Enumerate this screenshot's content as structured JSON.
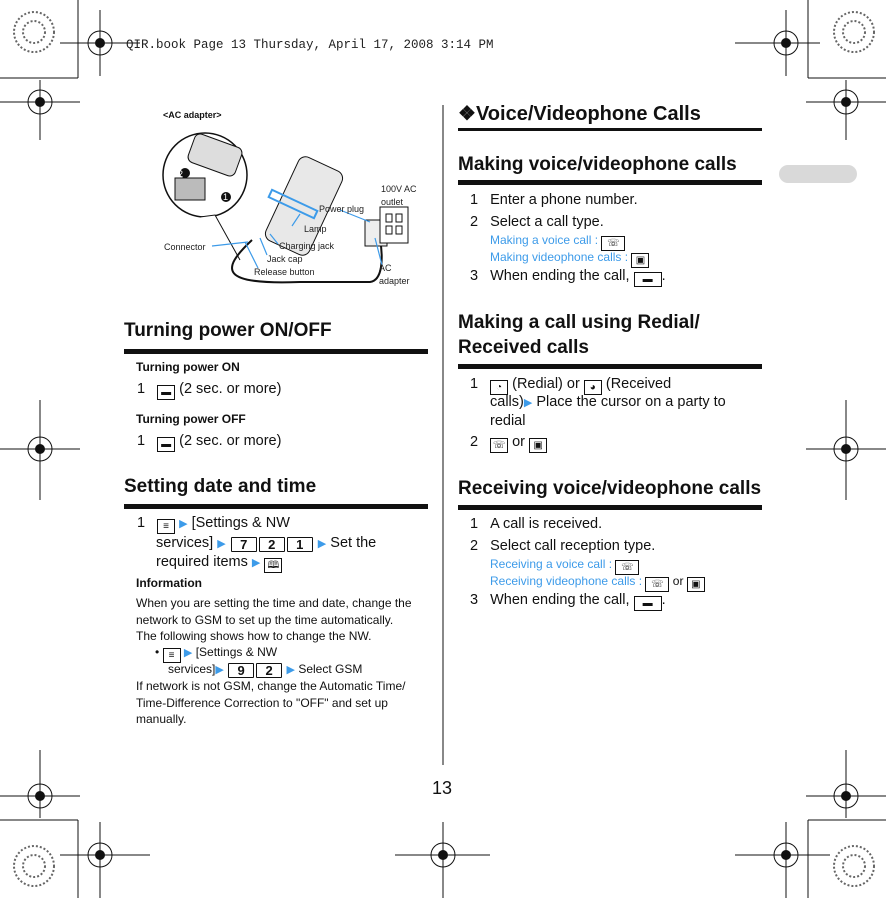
{
  "header": {
    "text": "QIR.book  Page 13  Thursday, April 17, 2008  3:14 PM"
  },
  "colors": {
    "accent": "#3d9be9",
    "tab": "#d9d9d9"
  },
  "diagram": {
    "title": "<AC adapter>",
    "labels": {
      "outlet": "100V AC",
      "outlet2": "outlet",
      "power_plug": "Power plug",
      "lamp": "Lamp",
      "connector": "Connector",
      "charging_jack": "Charging jack",
      "jack_cap": "Jack cap",
      "release": "Release button",
      "adapter": "AC",
      "adapter2": "adapter",
      "n1": "1",
      "n2": "2"
    }
  },
  "left": {
    "power": {
      "title": "Turning power ON/OFF",
      "on_title": "Turning power ON",
      "on_step": "(2 sec. or more)",
      "off_title": "Turning power OFF",
      "off_step": "(2 sec. or more)"
    },
    "date": {
      "title": "Setting date and time",
      "l1": "[Settings & NW",
      "l2a": "services]",
      "keys": [
        "7",
        "2",
        "1"
      ],
      "l2b": "Set the",
      "l3": "required items",
      "info_title": "Information",
      "info": [
        "When you are setting the time and date, change the",
        "network to GSM to set up the time automatically.",
        "The following shows how to change the NW."
      ],
      "b1": "[Settings & NW",
      "b2a": "services]",
      "bkeys": [
        "9",
        "2"
      ],
      "b2b": "Select GSM",
      "after": [
        "If network is not GSM, change the Automatic Time/",
        "Time-Difference Correction to \"OFF\" and set up",
        "manually."
      ]
    }
  },
  "right": {
    "title": "Voice/Videophone Calls",
    "title_mark": "❖",
    "making": {
      "title": "Making voice/videophone calls",
      "s1": "Enter a phone number.",
      "s2": "Select a call type.",
      "voice": "Making a voice call :",
      "video": "Making videophone calls :",
      "s3": "When ending the call,"
    },
    "redial": {
      "title1": "Making a call using Redial/",
      "title2": "Received calls",
      "s1a": "(Redial) or",
      "s1b": "(Received",
      "s1c": "calls)",
      "s1d": "Place the cursor on a party to",
      "s1e": "redial",
      "or": "or"
    },
    "receiving": {
      "title": "Receiving voice/videophone calls",
      "s1": "A call is received.",
      "s2": "Select call reception type.",
      "voice": "Receiving a voice call :",
      "video": "Receiving videophone calls :",
      "or": "or",
      "s3": "When ending the call,"
    }
  },
  "nums": {
    "1": "1",
    "2": "2",
    "3": "3"
  },
  "page_number": "13"
}
